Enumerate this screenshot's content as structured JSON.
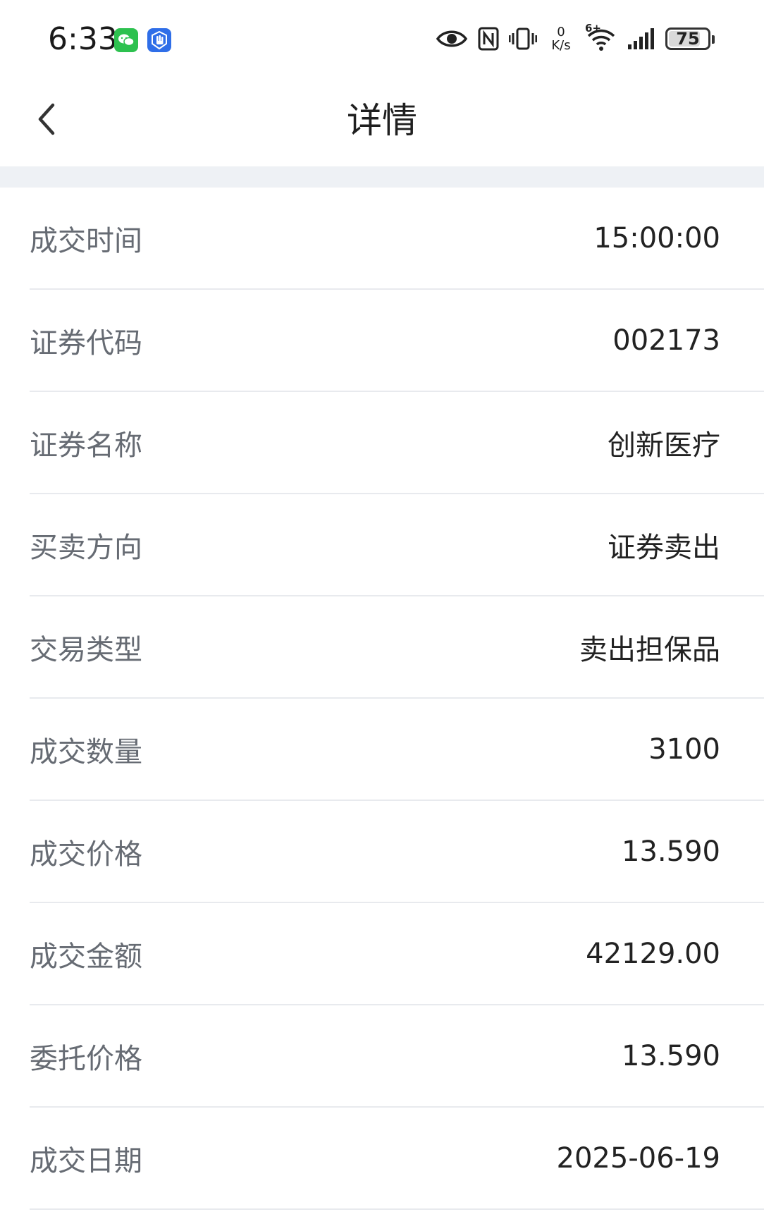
{
  "status_bar": {
    "time": "6:33",
    "net_speed_value": "0",
    "net_speed_unit": "K/s",
    "network_type": "6+",
    "battery_level": "75",
    "icons": [
      "wechat-icon",
      "hand-app-icon",
      "eye-icon",
      "nfc-icon",
      "vibrate-icon",
      "wifi-icon",
      "signal-icon",
      "battery-icon"
    ]
  },
  "nav": {
    "title": "详情",
    "back_icon": "chevron-left-icon"
  },
  "details": [
    {
      "label": "成交时间",
      "value": "15:00:00"
    },
    {
      "label": "证券代码",
      "value": "002173"
    },
    {
      "label": "证券名称",
      "value": "创新医疗"
    },
    {
      "label": "买卖方向",
      "value": "证券卖出"
    },
    {
      "label": "交易类型",
      "value": "卖出担保品"
    },
    {
      "label": "成交数量",
      "value": "3100"
    },
    {
      "label": "成交价格",
      "value": "13.590"
    },
    {
      "label": "成交金额",
      "value": "42129.00"
    },
    {
      "label": "委托价格",
      "value": "13.590"
    },
    {
      "label": "成交日期",
      "value": "2025-06-19"
    }
  ],
  "colors": {
    "label_text": "#666b73",
    "value_text": "#222222",
    "divider": "#e8eaee",
    "section_gap": "#eef1f5"
  }
}
